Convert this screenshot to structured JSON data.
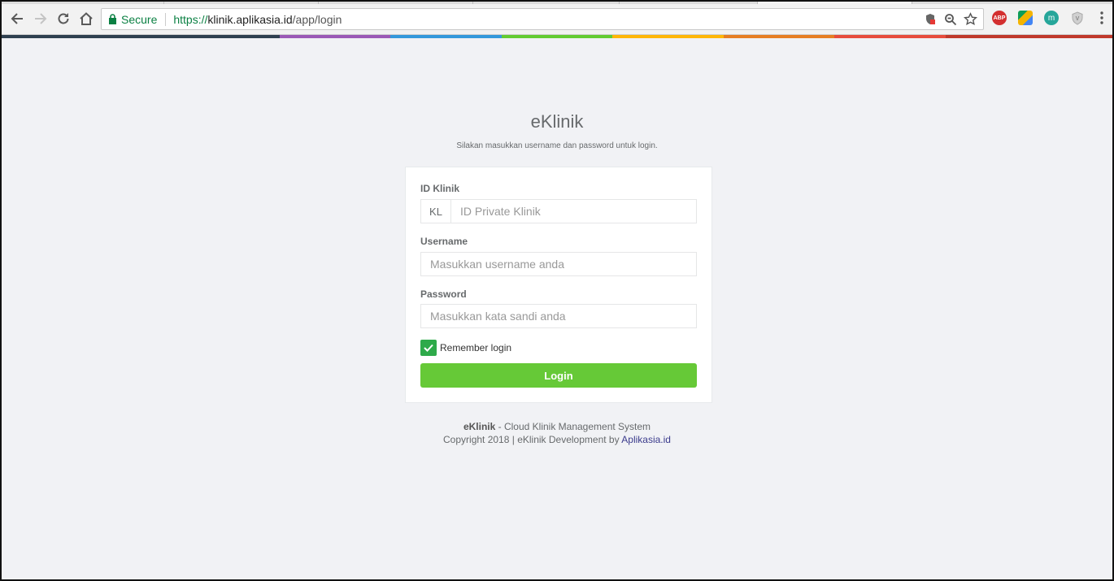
{
  "browser": {
    "secure_label": "Secure",
    "url_scheme": "https://",
    "url_host": "klinik.aplikasia.id",
    "url_path": "/app/login",
    "nav_icons": [
      "back-arrow-icon",
      "forward-arrow-icon",
      "reload-icon",
      "home-icon"
    ],
    "omnibox_icons": [
      "shield-icon",
      "zoom-icon",
      "star-icon"
    ],
    "extensions": [
      {
        "name": "adblock-plus-icon",
        "text": "ABP",
        "color": "#d32f2f"
      },
      {
        "name": "google-drive-icon",
        "text": "",
        "color": "#f4b400"
      },
      {
        "name": "m-extension-icon",
        "text": "m",
        "color": "#26a69a"
      },
      {
        "name": "shield-extension-icon",
        "text": "",
        "color": "#bdbdbd"
      }
    ],
    "menu_icon": "more-vertical-icon"
  },
  "rainbow_colors": [
    "#2f4050",
    "#9b59b6",
    "#3498db",
    "#62cb31",
    "#ffb606",
    "#e67e22",
    "#e74c3c",
    "#c0392b"
  ],
  "login": {
    "title": "eKlinik",
    "subtitle": "Silakan masukkan username dan password untuk login.",
    "id_label": "ID Klinik",
    "id_prefix": "KL",
    "id_placeholder": "ID Private Klinik",
    "username_label": "Username",
    "username_placeholder": "Masukkan username anda",
    "password_label": "Password",
    "password_placeholder": "Masukkan kata sandi anda",
    "remember_label": "Remember login",
    "remember_checked": true,
    "button_label": "Login"
  },
  "footer": {
    "brand": "eKlinik",
    "tagline": " - Cloud Klinik Management System",
    "copyright": "Copyright 2018 | eKlinik Development by ",
    "company": "Aplikasia.id"
  }
}
